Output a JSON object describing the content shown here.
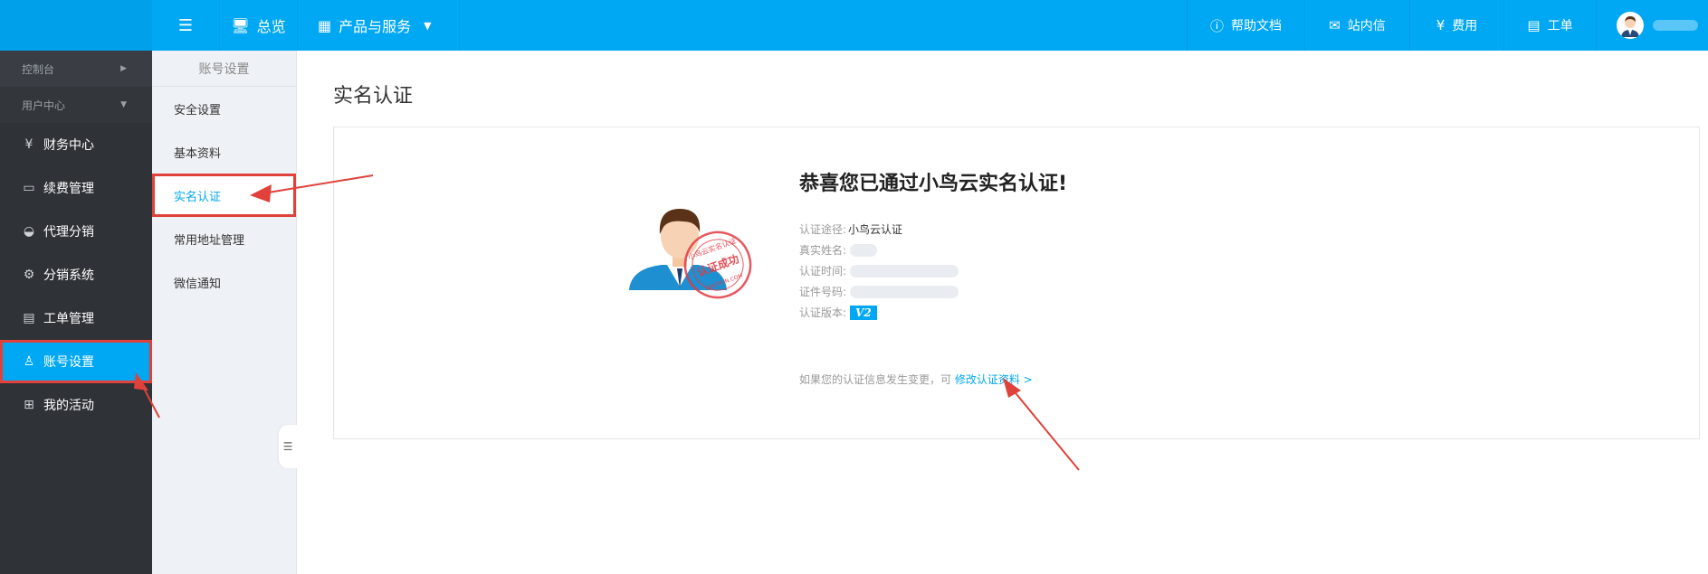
{
  "topbar": {
    "menu_icon": "menu-fold-icon",
    "overview": "总览",
    "products": "产品与服务",
    "help_docs": "帮助文档",
    "messages": "站内信",
    "fees": "费用",
    "tickets": "工单"
  },
  "sidebar": {
    "sections": [
      {
        "label": "控制台"
      },
      {
        "label": "用户中心"
      }
    ],
    "items": [
      {
        "label": "财务中心",
        "icon": "yen-circle-icon"
      },
      {
        "label": "续费管理",
        "icon": "renew-icon"
      },
      {
        "label": "代理分销",
        "icon": "basket-icon"
      },
      {
        "label": "分销系统",
        "icon": "gear-icon"
      },
      {
        "label": "工单管理",
        "icon": "document-icon"
      },
      {
        "label": "账号设置",
        "icon": "user-icon"
      },
      {
        "label": "我的活动",
        "icon": "gift-icon"
      }
    ]
  },
  "subnav": {
    "header": "账号设置",
    "links": [
      {
        "label": "安全设置"
      },
      {
        "label": "基本资料"
      },
      {
        "label": "实名认证"
      },
      {
        "label": "常用地址管理"
      },
      {
        "label": "微信通知"
      }
    ]
  },
  "main": {
    "page_title": "实名认证",
    "headline": "恭喜您已通过小鸟云实名认证!",
    "fields": {
      "method_label": "认证途径:",
      "method_value": "小鸟云认证",
      "name_label": "真实姓名:",
      "time_label": "认证时间:",
      "id_label": "证件号码:",
      "version_label": "认证版本:",
      "version_badge": "V2"
    },
    "note_text": "如果您的认证信息发生变更，可",
    "note_link": "修改认证资料 >",
    "stamp_text": "小鸟云实名认证",
    "stamp_center": "认证成功",
    "stamp_bottom": "NIAOYUN.COM"
  },
  "colors": {
    "primary": "#00a8f3",
    "sidebar_bg": "#2f3237",
    "highlight_red": "#e0413a"
  }
}
